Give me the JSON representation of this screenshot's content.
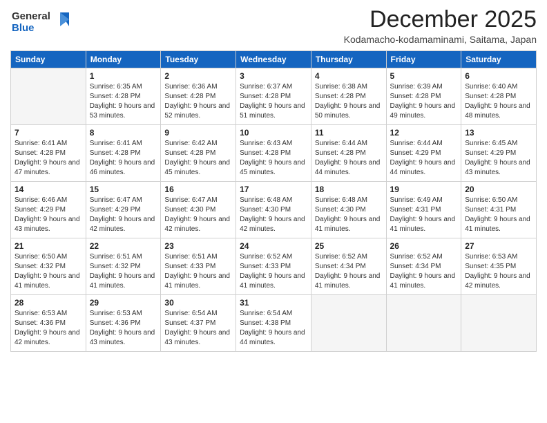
{
  "logo": {
    "general": "General",
    "blue": "Blue"
  },
  "title": "December 2025",
  "subtitle": "Kodamacho-kodamaminami, Saitama, Japan",
  "headers": [
    "Sunday",
    "Monday",
    "Tuesday",
    "Wednesday",
    "Thursday",
    "Friday",
    "Saturday"
  ],
  "weeks": [
    [
      {
        "day": "",
        "sunrise": "",
        "sunset": "",
        "daylight": ""
      },
      {
        "day": "1",
        "sunrise": "Sunrise: 6:35 AM",
        "sunset": "Sunset: 4:28 PM",
        "daylight": "Daylight: 9 hours and 53 minutes."
      },
      {
        "day": "2",
        "sunrise": "Sunrise: 6:36 AM",
        "sunset": "Sunset: 4:28 PM",
        "daylight": "Daylight: 9 hours and 52 minutes."
      },
      {
        "day": "3",
        "sunrise": "Sunrise: 6:37 AM",
        "sunset": "Sunset: 4:28 PM",
        "daylight": "Daylight: 9 hours and 51 minutes."
      },
      {
        "day": "4",
        "sunrise": "Sunrise: 6:38 AM",
        "sunset": "Sunset: 4:28 PM",
        "daylight": "Daylight: 9 hours and 50 minutes."
      },
      {
        "day": "5",
        "sunrise": "Sunrise: 6:39 AM",
        "sunset": "Sunset: 4:28 PM",
        "daylight": "Daylight: 9 hours and 49 minutes."
      },
      {
        "day": "6",
        "sunrise": "Sunrise: 6:40 AM",
        "sunset": "Sunset: 4:28 PM",
        "daylight": "Daylight: 9 hours and 48 minutes."
      }
    ],
    [
      {
        "day": "7",
        "sunrise": "Sunrise: 6:41 AM",
        "sunset": "Sunset: 4:28 PM",
        "daylight": "Daylight: 9 hours and 47 minutes."
      },
      {
        "day": "8",
        "sunrise": "Sunrise: 6:41 AM",
        "sunset": "Sunset: 4:28 PM",
        "daylight": "Daylight: 9 hours and 46 minutes."
      },
      {
        "day": "9",
        "sunrise": "Sunrise: 6:42 AM",
        "sunset": "Sunset: 4:28 PM",
        "daylight": "Daylight: 9 hours and 45 minutes."
      },
      {
        "day": "10",
        "sunrise": "Sunrise: 6:43 AM",
        "sunset": "Sunset: 4:28 PM",
        "daylight": "Daylight: 9 hours and 45 minutes."
      },
      {
        "day": "11",
        "sunrise": "Sunrise: 6:44 AM",
        "sunset": "Sunset: 4:28 PM",
        "daylight": "Daylight: 9 hours and 44 minutes."
      },
      {
        "day": "12",
        "sunrise": "Sunrise: 6:44 AM",
        "sunset": "Sunset: 4:29 PM",
        "daylight": "Daylight: 9 hours and 44 minutes."
      },
      {
        "day": "13",
        "sunrise": "Sunrise: 6:45 AM",
        "sunset": "Sunset: 4:29 PM",
        "daylight": "Daylight: 9 hours and 43 minutes."
      }
    ],
    [
      {
        "day": "14",
        "sunrise": "Sunrise: 6:46 AM",
        "sunset": "Sunset: 4:29 PM",
        "daylight": "Daylight: 9 hours and 43 minutes."
      },
      {
        "day": "15",
        "sunrise": "Sunrise: 6:47 AM",
        "sunset": "Sunset: 4:29 PM",
        "daylight": "Daylight: 9 hours and 42 minutes."
      },
      {
        "day": "16",
        "sunrise": "Sunrise: 6:47 AM",
        "sunset": "Sunset: 4:30 PM",
        "daylight": "Daylight: 9 hours and 42 minutes."
      },
      {
        "day": "17",
        "sunrise": "Sunrise: 6:48 AM",
        "sunset": "Sunset: 4:30 PM",
        "daylight": "Daylight: 9 hours and 42 minutes."
      },
      {
        "day": "18",
        "sunrise": "Sunrise: 6:48 AM",
        "sunset": "Sunset: 4:30 PM",
        "daylight": "Daylight: 9 hours and 41 minutes."
      },
      {
        "day": "19",
        "sunrise": "Sunrise: 6:49 AM",
        "sunset": "Sunset: 4:31 PM",
        "daylight": "Daylight: 9 hours and 41 minutes."
      },
      {
        "day": "20",
        "sunrise": "Sunrise: 6:50 AM",
        "sunset": "Sunset: 4:31 PM",
        "daylight": "Daylight: 9 hours and 41 minutes."
      }
    ],
    [
      {
        "day": "21",
        "sunrise": "Sunrise: 6:50 AM",
        "sunset": "Sunset: 4:32 PM",
        "daylight": "Daylight: 9 hours and 41 minutes."
      },
      {
        "day": "22",
        "sunrise": "Sunrise: 6:51 AM",
        "sunset": "Sunset: 4:32 PM",
        "daylight": "Daylight: 9 hours and 41 minutes."
      },
      {
        "day": "23",
        "sunrise": "Sunrise: 6:51 AM",
        "sunset": "Sunset: 4:33 PM",
        "daylight": "Daylight: 9 hours and 41 minutes."
      },
      {
        "day": "24",
        "sunrise": "Sunrise: 6:52 AM",
        "sunset": "Sunset: 4:33 PM",
        "daylight": "Daylight: 9 hours and 41 minutes."
      },
      {
        "day": "25",
        "sunrise": "Sunrise: 6:52 AM",
        "sunset": "Sunset: 4:34 PM",
        "daylight": "Daylight: 9 hours and 41 minutes."
      },
      {
        "day": "26",
        "sunrise": "Sunrise: 6:52 AM",
        "sunset": "Sunset: 4:34 PM",
        "daylight": "Daylight: 9 hours and 41 minutes."
      },
      {
        "day": "27",
        "sunrise": "Sunrise: 6:53 AM",
        "sunset": "Sunset: 4:35 PM",
        "daylight": "Daylight: 9 hours and 42 minutes."
      }
    ],
    [
      {
        "day": "28",
        "sunrise": "Sunrise: 6:53 AM",
        "sunset": "Sunset: 4:36 PM",
        "daylight": "Daylight: 9 hours and 42 minutes."
      },
      {
        "day": "29",
        "sunrise": "Sunrise: 6:53 AM",
        "sunset": "Sunset: 4:36 PM",
        "daylight": "Daylight: 9 hours and 43 minutes."
      },
      {
        "day": "30",
        "sunrise": "Sunrise: 6:54 AM",
        "sunset": "Sunset: 4:37 PM",
        "daylight": "Daylight: 9 hours and 43 minutes."
      },
      {
        "day": "31",
        "sunrise": "Sunrise: 6:54 AM",
        "sunset": "Sunset: 4:38 PM",
        "daylight": "Daylight: 9 hours and 44 minutes."
      },
      {
        "day": "",
        "sunrise": "",
        "sunset": "",
        "daylight": ""
      },
      {
        "day": "",
        "sunrise": "",
        "sunset": "",
        "daylight": ""
      },
      {
        "day": "",
        "sunrise": "",
        "sunset": "",
        "daylight": ""
      }
    ]
  ]
}
